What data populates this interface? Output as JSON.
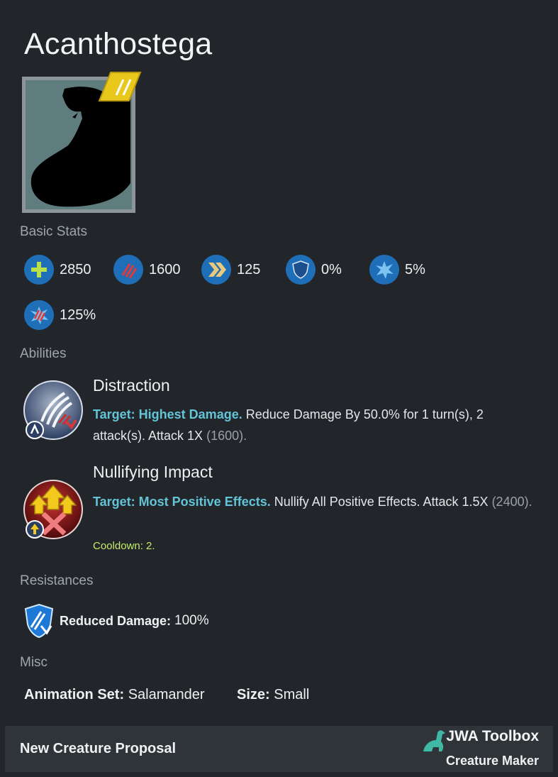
{
  "creature": {
    "name": "Acanthostega"
  },
  "sections": {
    "basic_stats": "Basic Stats",
    "abilities": "Abilities",
    "resistances": "Resistances",
    "misc": "Misc"
  },
  "stats": [
    {
      "icon": "health-icon",
      "value": "2850",
      "color": "#1f6fb8"
    },
    {
      "icon": "damage-icon",
      "value": "1600",
      "color": "#1f6fb8"
    },
    {
      "icon": "speed-icon",
      "value": "125",
      "color": "#1f6fb8"
    },
    {
      "icon": "armor-icon",
      "value": "0%",
      "color": "#1f6fb8"
    },
    {
      "icon": "crit-chance-icon",
      "value": "5%",
      "color": "#1f6fb8"
    },
    {
      "icon": "crit-multiplier-icon",
      "value": "125%",
      "color": "#1f6fb8"
    }
  ],
  "abilities": [
    {
      "name": "Distraction",
      "target": "Target: Highest Damage.",
      "text": "Reduce Damage By 50.0% for 1 turn(s), 2 attack(s). Attack 1X",
      "damage": "(1600)."
    },
    {
      "name": "Nullifying Impact",
      "target": "Target: Most Positive Effects.",
      "text": "Nullify All Positive Effects. Attack 1.5X",
      "damage": "(2400).",
      "cooldown": "Cooldown: 2."
    }
  ],
  "resistances": [
    {
      "label": "Reduced Damage:",
      "value": "100%"
    }
  ],
  "misc": {
    "animation_label": "Animation Set:",
    "animation_value": "Salamander",
    "size_label": "Size:",
    "size_value": "Small"
  },
  "footer": {
    "proposal": "New Creature Proposal",
    "brand": "JWA Toolbox",
    "brand_sub": "Creature Maker"
  },
  "colors": {
    "background": "#22262a",
    "target_text": "#62c4d6",
    "cooldown_text": "#c5ec6a",
    "rarity_badge": "#e8c81a"
  }
}
